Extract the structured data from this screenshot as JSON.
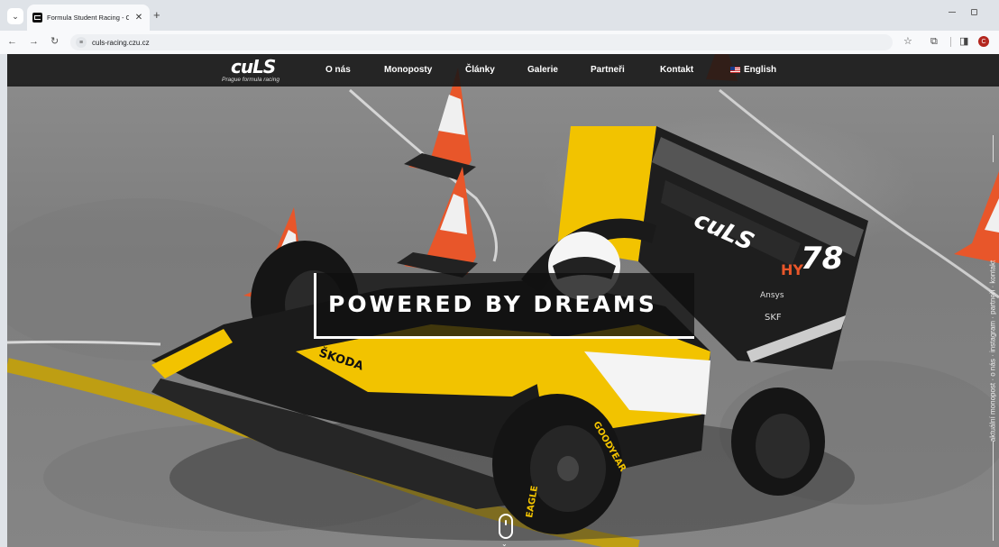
{
  "browser": {
    "tab_title": "Formula Student Racing - CULS",
    "tab_close": "✕",
    "new_tab": "+",
    "url": "culs-racing.czu.cz",
    "avatar_letter": "C"
  },
  "site": {
    "logo_text": "cuLS",
    "logo_subtitle": "Prague formula racing",
    "nav": {
      "about": "O nás",
      "cars": "Monoposty",
      "articles": "Články",
      "gallery": "Galerie",
      "partners": "Partneři",
      "contact": "Kontakt",
      "english": "English"
    },
    "headline": "POWERED BY DREAMS",
    "side_links": "aktuální monopost  ·  o nás  ·  instagram  ·  partneři  ·  kontakt"
  },
  "car": {
    "number": "78",
    "wing_logo": "cuLS",
    "sponsors": [
      "ŠKODA",
      "GOODYEAR",
      "EAGLE",
      "Ansys",
      "SKF"
    ]
  },
  "colors": {
    "car_yellow": "#f2c300",
    "car_black": "#1b1b1b",
    "cone_orange": "#e8562a",
    "nav_bg": "#141414"
  }
}
